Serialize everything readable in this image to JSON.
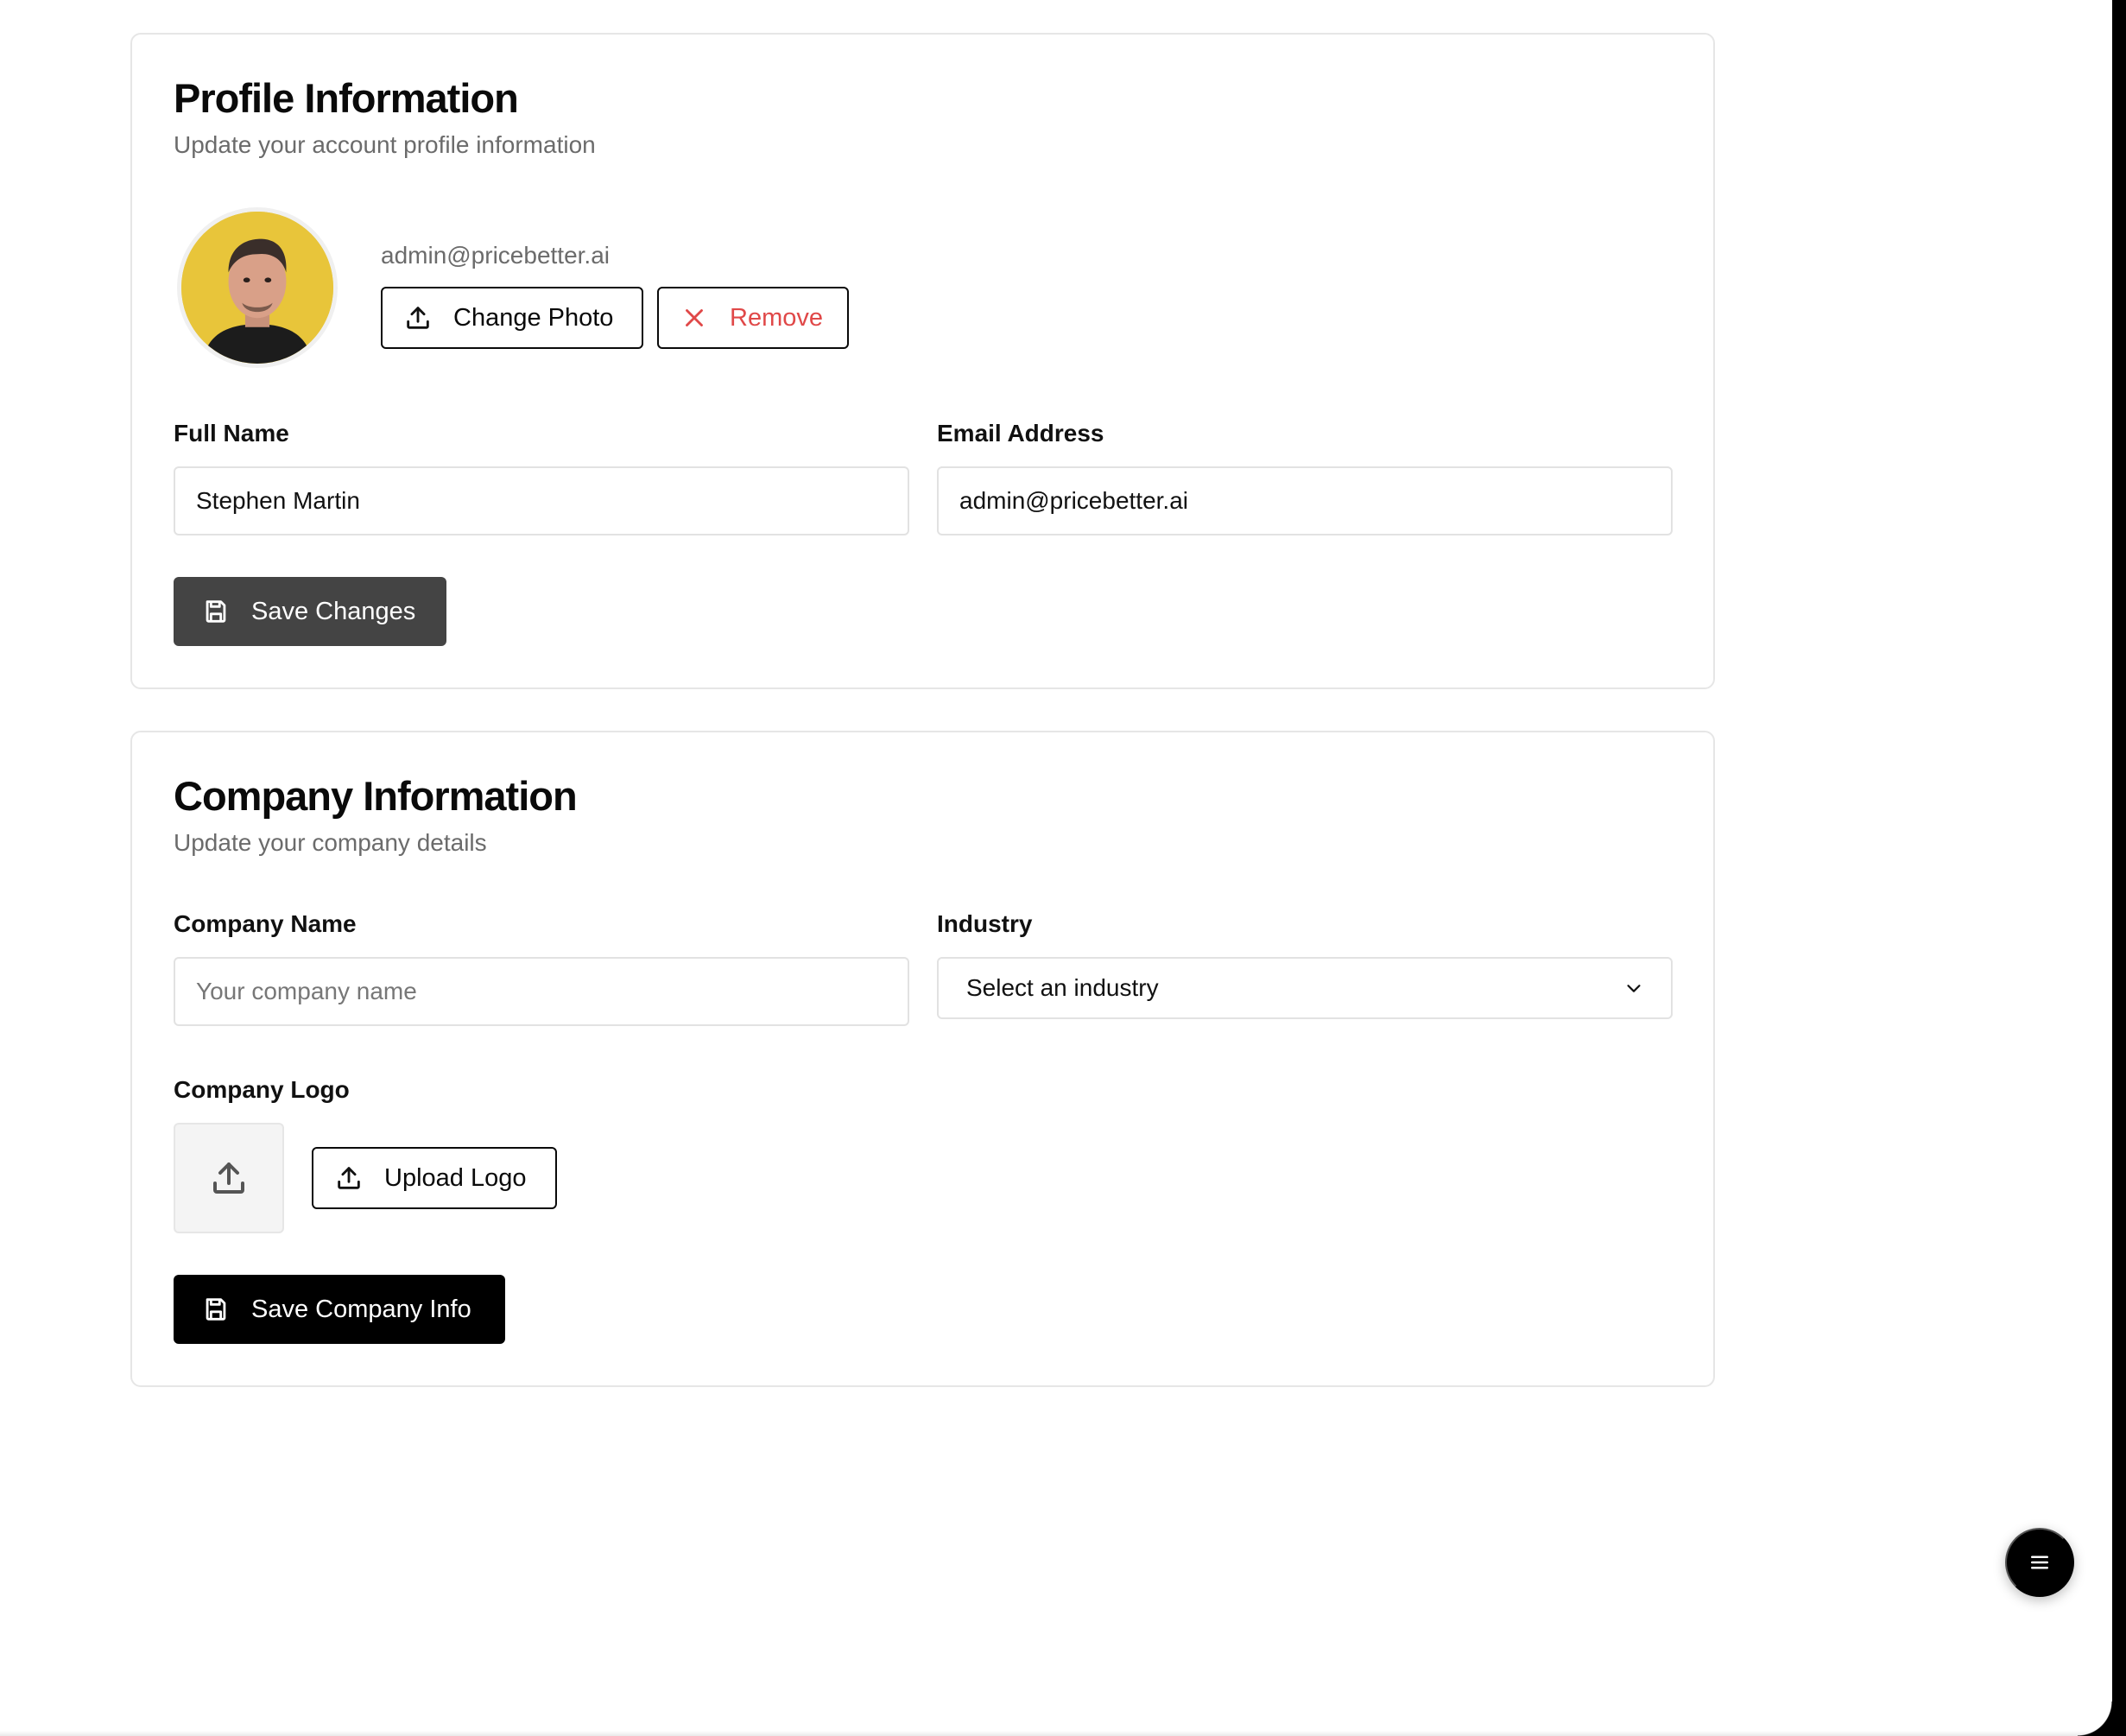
{
  "profile": {
    "title": "Profile Information",
    "subtitle": "Update your account profile information",
    "email_caption": "admin@pricebetter.ai",
    "change_photo_label": "Change Photo",
    "remove_label": "Remove",
    "full_name_label": "Full Name",
    "full_name_value": "Stephen Martin",
    "email_label": "Email Address",
    "email_value": "admin@pricebetter.ai",
    "save_label": "Save Changes"
  },
  "company": {
    "title": "Company Information",
    "subtitle": "Update your company details",
    "name_label": "Company Name",
    "name_placeholder": "Your company name",
    "industry_label": "Industry",
    "industry_selected": "Select an industry",
    "logo_label": "Company Logo",
    "upload_logo_label": "Upload Logo",
    "save_label": "Save Company Info"
  },
  "icons": {
    "upload": "upload-icon",
    "close": "close-icon",
    "save": "save-icon",
    "chevron": "chevron-down-icon",
    "menu": "menu-icon"
  },
  "colors": {
    "danger": "#e04848",
    "avatar_bg": "#e8c53a",
    "save_dark": "#444444",
    "primary_black": "#000000"
  }
}
